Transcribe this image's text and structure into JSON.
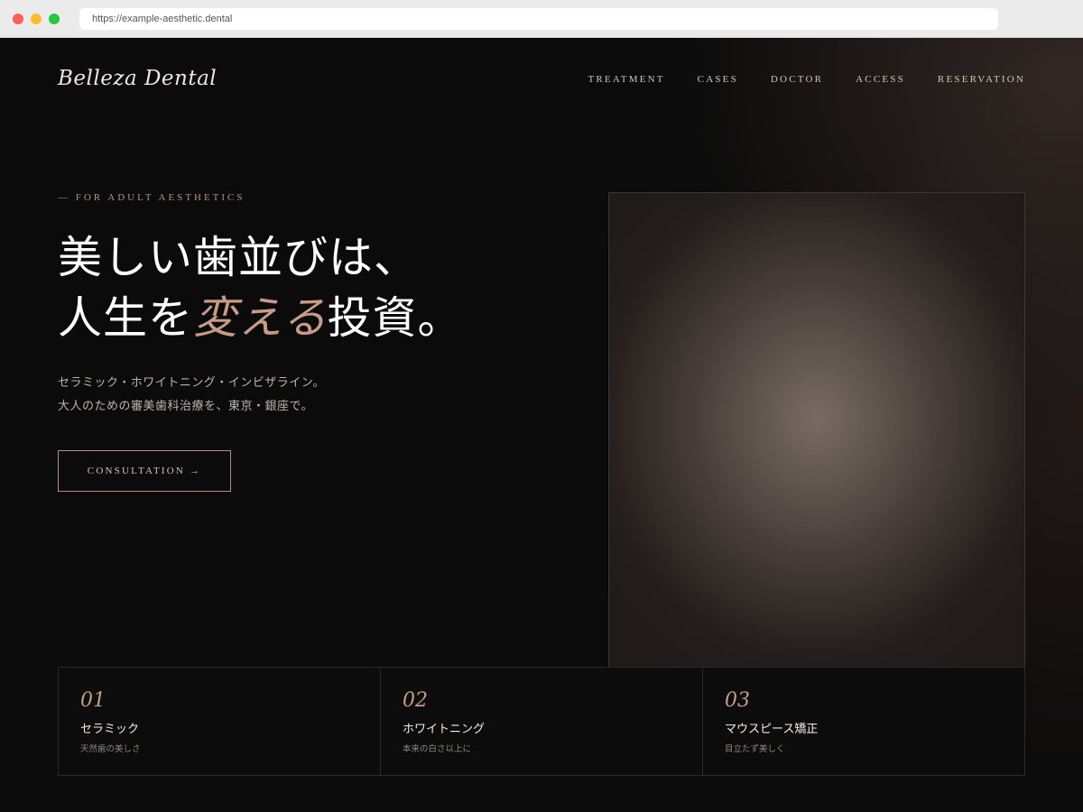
{
  "browser": {
    "url": "https://example-aesthetic.dental"
  },
  "header": {
    "logo": "Belleza Dental",
    "nav": [
      {
        "label": "TREATMENT"
      },
      {
        "label": "CASES"
      },
      {
        "label": "DOCTOR"
      },
      {
        "label": "ACCESS"
      },
      {
        "label": "RESERVATION"
      }
    ]
  },
  "hero": {
    "eyebrow": "— FOR ADULT AESTHETICS",
    "headline_line1": "美しい歯並びは、",
    "headline_line2_pre": "人生を",
    "headline_line2_accent": "変える",
    "headline_line2_post": "投資。",
    "lead_line1": "セラミック・ホワイトニング・インビザライン。",
    "lead_line2": "大人のための審美歯科治療を、東京・銀座で。",
    "cta_label": "CONSULTATION →"
  },
  "features": [
    {
      "num": "01",
      "title": "セラミック",
      "sub": "天然歯の美しさ"
    },
    {
      "num": "02",
      "title": "ホワイトニング",
      "sub": "本来の白さ以上に"
    },
    {
      "num": "03",
      "title": "マウスピース矯正",
      "sub": "目立たず美しく"
    }
  ],
  "colors": {
    "background": "#0b0b0b",
    "accent": "#c89a87",
    "text": "#ffffff"
  }
}
